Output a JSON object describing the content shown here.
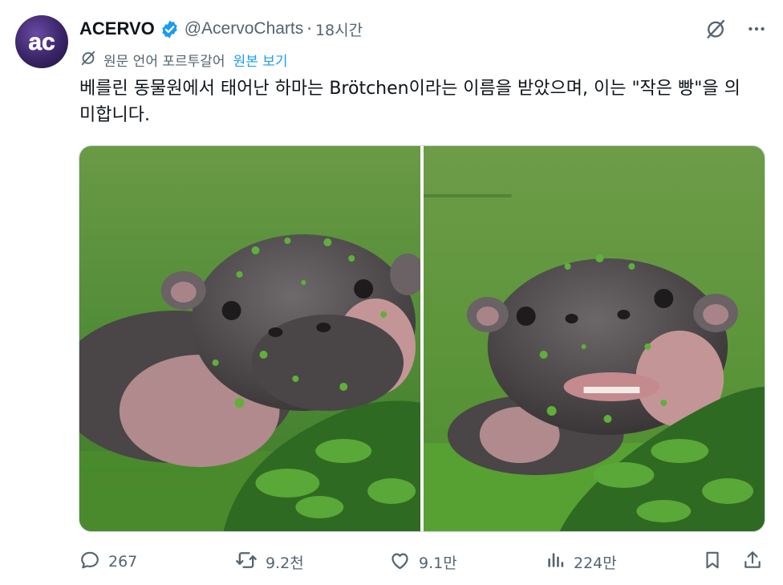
{
  "author": {
    "display_name": "ACERVO",
    "handle": "@AcervoCharts",
    "separator": "·",
    "time": "18시간",
    "avatar_text": "ac"
  },
  "translation": {
    "label": "원문 언어 포르투갈어",
    "show_original": "원본 보기"
  },
  "tweet": {
    "text": "베를린 동물원에서 태어난 하마는 Brötchen이라는 이름을 받았으며, 이는 \"작은 빵\"을 의미합니다."
  },
  "actions": {
    "replies": "267",
    "retweets": "9.2천",
    "likes": "9.1만",
    "views": "224만"
  },
  "colors": {
    "accent": "#1d9bf0",
    "muted": "#536471",
    "text": "#0f1419"
  },
  "icons": [
    "verified-badge-icon",
    "grok-icon",
    "more-icon",
    "translate-icon",
    "reply-icon",
    "retweet-icon",
    "like-icon",
    "views-icon",
    "bookmark-icon",
    "share-icon"
  ]
}
